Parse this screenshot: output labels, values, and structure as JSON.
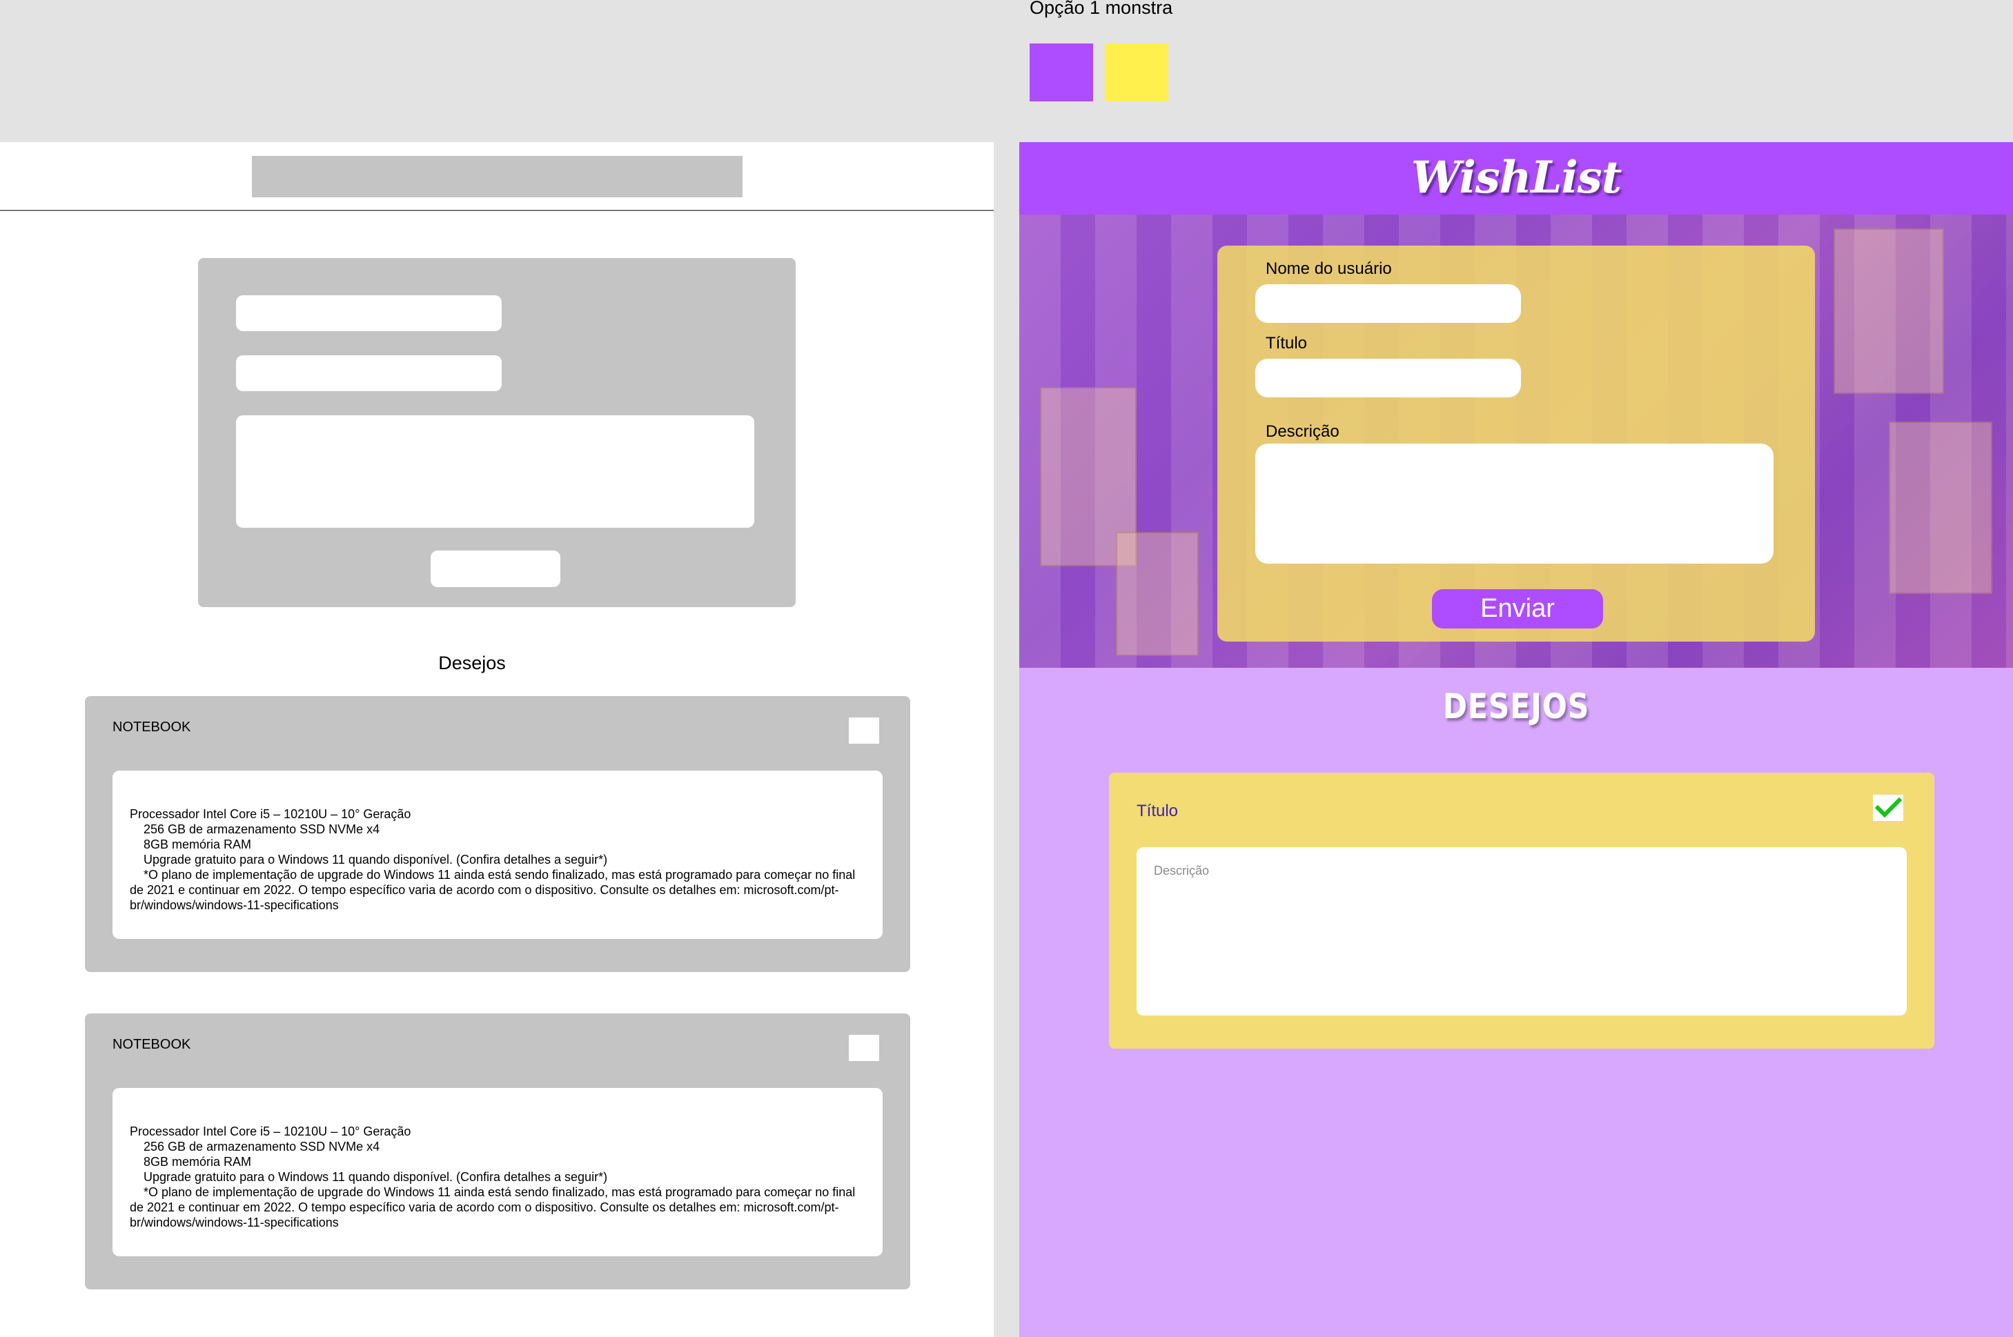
{
  "palette": {
    "title": "Opção 1 monstra",
    "colors": [
      "#ad4dff",
      "#fff04d"
    ]
  },
  "wireframe": {
    "section_title": "Desejos",
    "cards": [
      {
        "title": "NOTEBOOK",
        "lines": [
          "Processador Intel Core i5 – 10210U – 10° Geração",
          "256 GB de armazenamento SSD NVMe x4",
          "8GB memória RAM",
          "Upgrade gratuito para o Windows 11 quando disponível. (Confira detalhes a seguir*)",
          "*O plano de implementação de upgrade do Windows 11 ainda está sendo finalizado, mas está programado para começar no final de 2021 e continuar em 2022. O tempo específico varia de acordo com o dispositivo. Consulte os detalhes em: microsoft.com/pt-br/windows/windows-11-specifications"
        ]
      },
      {
        "title": "NOTEBOOK",
        "lines": [
          "Processador Intel Core i5 – 10210U – 10° Geração",
          "256 GB de armazenamento SSD NVMe x4",
          "8GB memória RAM",
          "Upgrade gratuito para o Windows 11 quando disponível. (Confira detalhes a seguir*)",
          "*O plano de implementação de upgrade do Windows 11 ainda está sendo finalizado, mas está programado para começar no final de 2021 e continuar em 2022. O tempo específico varia de acordo com o dispositivo. Consulte os detalhes em: microsoft.com/pt-br/windows/windows-11-specifications"
        ]
      }
    ]
  },
  "mock": {
    "logo": "WishList",
    "form": {
      "user_label": "Nome do usuário",
      "title_label": "Título",
      "description_label": "Descrição",
      "submit_label": "Enviar"
    },
    "section_title": "DESEJOS",
    "card": {
      "title": "Título",
      "description_placeholder": "Descrição",
      "checked": true,
      "check_icon": "checkmark-icon",
      "check_color": "#18c21a"
    },
    "colors": {
      "header": "#ad4dff",
      "background": "#d8a8fe",
      "card": "#f3dc73"
    }
  }
}
